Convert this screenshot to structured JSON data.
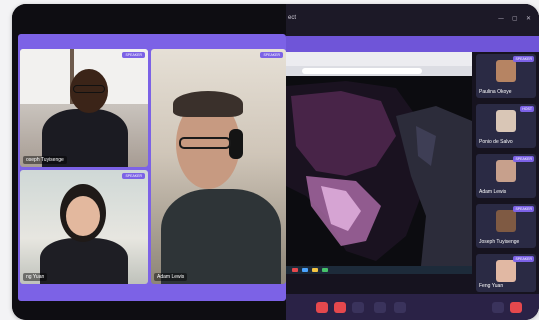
{
  "window": {
    "title": "ect"
  },
  "grid_tiles": [
    {
      "name": "oseph Tuyisenge",
      "badge": "SPEAKER"
    },
    {
      "name": "Adam Lewis",
      "badge": "SPEAKER"
    },
    {
      "name": "ng Yuan",
      "badge": "SPEAKER"
    }
  ],
  "participants": [
    {
      "name": "Paulina Okoye",
      "badge": "SPEAKER"
    },
    {
      "name": "Ponio de Salvo",
      "badge": "HOST"
    },
    {
      "name": "Adam Lewis",
      "badge": "SPEAKER"
    },
    {
      "name": "Joseph Tuyisenge",
      "badge": "SPEAKER"
    },
    {
      "name": "Feng Yuan",
      "badge": "SPEAKER"
    }
  ],
  "colors": {
    "accent": "#7c62e6",
    "end_call": "#e5484d"
  }
}
